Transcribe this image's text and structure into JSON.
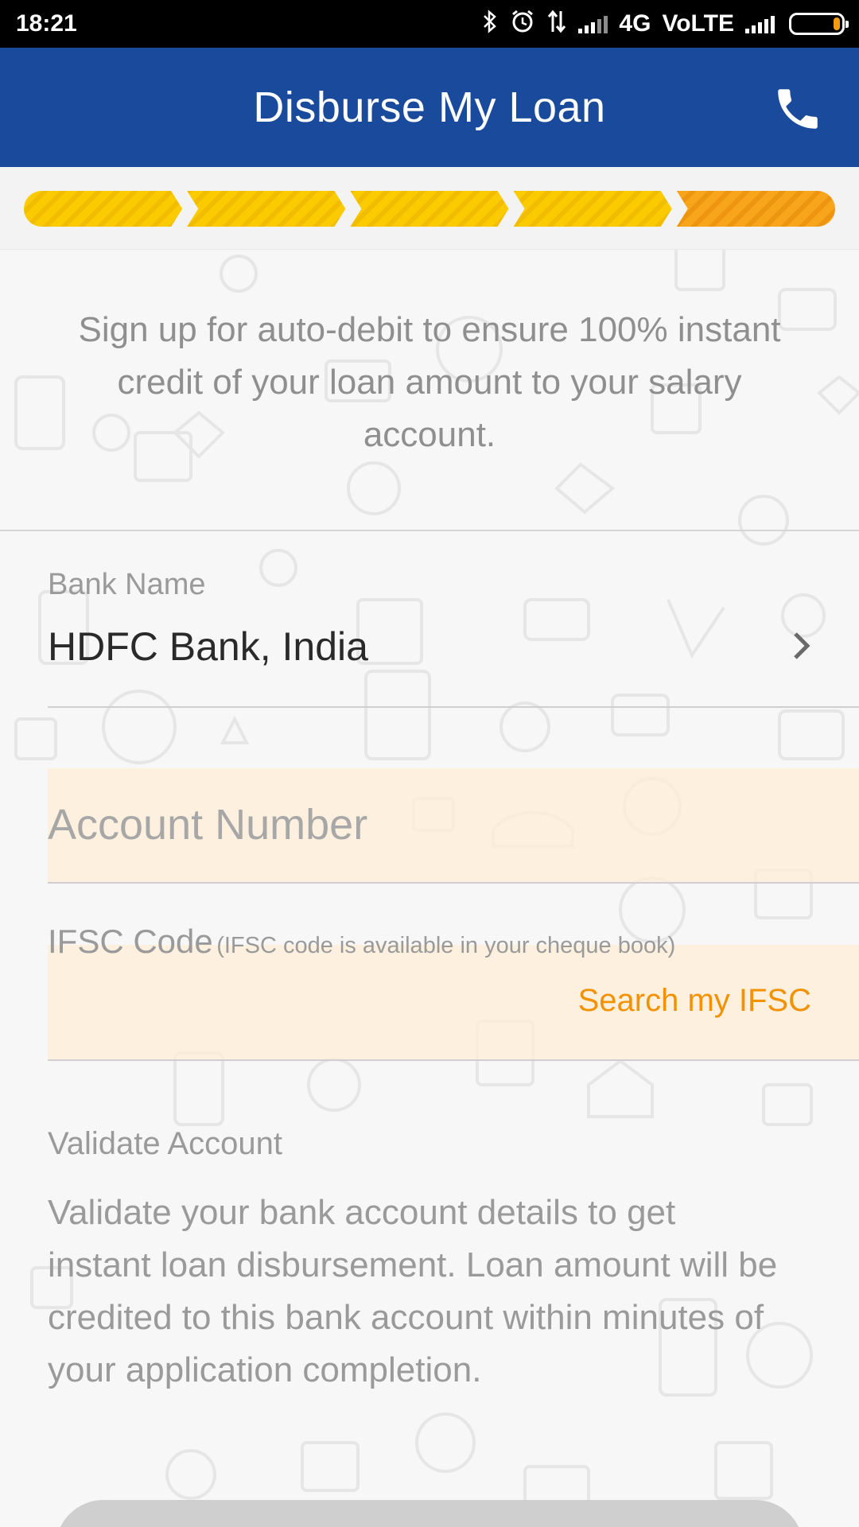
{
  "status_bar": {
    "time": "18:21",
    "network": "4G",
    "volte": "VoLTE",
    "icons": [
      "bluetooth-icon",
      "alarm-icon",
      "data-transfer-icon",
      "signal-icon",
      "battery-icon"
    ]
  },
  "header": {
    "title": "Disburse My Loan",
    "phone_icon": "phone-icon"
  },
  "progress": {
    "total_steps": 5,
    "current_step": 5,
    "completed_color": "#f9c800",
    "current_color": "#f7a21a"
  },
  "intro": {
    "text": "Sign up for auto-debit to ensure 100% instant credit of your loan amount to your salary account."
  },
  "bank": {
    "label": "Bank Name",
    "value": "HDFC Bank, India"
  },
  "account": {
    "placeholder": "Account Number"
  },
  "ifsc": {
    "label": "IFSC Code",
    "hint": "(IFSC code is available in your cheque book)",
    "search_label": "Search my IFSC"
  },
  "validate": {
    "title": "Validate Account",
    "body": "Validate your bank account details to get instant loan disbursement. Loan amount will be credited to this bank account within minutes of your application completion."
  },
  "colors": {
    "header_bg": "#1a4a9b",
    "accent_orange": "#f39200",
    "field_highlight": "#ffeed6"
  }
}
